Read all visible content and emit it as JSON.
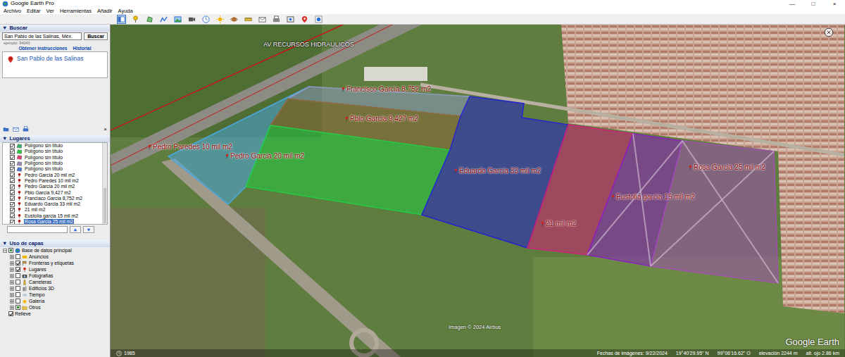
{
  "window": {
    "title": "Google Earth Pro",
    "controls": [
      "—",
      "□",
      "×"
    ]
  },
  "menu": [
    "Archivo",
    "Editar",
    "Ver",
    "Herramientas",
    "Añadir",
    "Ayuda"
  ],
  "toolbar": {
    "buttons": [
      {
        "selected": true
      },
      {
        "selected": false
      },
      {
        "selected": false
      },
      {
        "selected": false
      },
      {
        "selected": false
      },
      {
        "selected": false
      },
      {
        "selected": false
      },
      {
        "selected": false
      },
      {
        "selected": false
      },
      {
        "selected": false
      },
      {
        "selected": false
      },
      {
        "selected": false
      },
      {
        "selected": false
      },
      {
        "selected": false
      },
      {
        "selected": false
      }
    ]
  },
  "search": {
    "collapse": "▼",
    "header": "Buscar",
    "value": "San Pablo de las Salinas, Méx.",
    "button": "Buscar",
    "hint": "ejemplo: 94043",
    "links": [
      "Obtener instrucciones",
      "Historial"
    ],
    "results": [
      {
        "label": "San Pablo de las Salinas",
        "selected": false
      }
    ],
    "close": "×"
  },
  "places": {
    "collapse": "▼",
    "header": "Lugares",
    "items": [
      {
        "label": "Polígono sin título",
        "checked": true,
        "kind": "polygon",
        "color": "#3cb371",
        "selected": false
      },
      {
        "label": "Polígono sin título",
        "checked": true,
        "kind": "polygon",
        "color": "#2ecc40",
        "selected": false
      },
      {
        "label": "Polígono sin título",
        "checked": true,
        "kind": "polygon",
        "color": "#e04070",
        "selected": false
      },
      {
        "label": "Polígono sin título",
        "checked": true,
        "kind": "polygon",
        "color": "#9a8ab0",
        "selected": false
      },
      {
        "label": "Polígono sin título",
        "checked": true,
        "kind": "polygon",
        "color": "#4a7bd0",
        "selected": false
      },
      {
        "label": "Pedro Garcia 20 mil m2",
        "checked": true,
        "kind": "pin",
        "color": "#b01818",
        "selected": false
      },
      {
        "label": "Pedro Paredes 10 mil m2",
        "checked": true,
        "kind": "pin",
        "color": "#b01818",
        "selected": false
      },
      {
        "label": "Pedro Garcia 20 mil m2",
        "checked": true,
        "kind": "pin",
        "color": "#b01818",
        "selected": false
      },
      {
        "label": "Pblo Garcia 9,427 m2",
        "checked": true,
        "kind": "pin",
        "color": "#b01818",
        "selected": false
      },
      {
        "label": "Franciaco Garcia 8,752 m2",
        "checked": true,
        "kind": "pin",
        "color": "#b01818",
        "selected": false
      },
      {
        "label": "Eduardo Garcia 33 mil m2",
        "checked": true,
        "kind": "pin",
        "color": "#b01818",
        "selected": false
      },
      {
        "label": "21 mil m2",
        "checked": true,
        "kind": "pin",
        "color": "#b01818",
        "selected": false
      },
      {
        "label": "Eustolia garcia 15 mil m2",
        "checked": true,
        "kind": "pin",
        "color": "#b01818",
        "selected": false
      },
      {
        "label": "Rosa Garcia 25 mil m2",
        "checked": true,
        "kind": "pin",
        "color": "#b01818",
        "selected": true
      }
    ]
  },
  "layers": {
    "collapse": "▼",
    "header": "Uso de capas",
    "items": [
      {
        "label": "Base de datos principal",
        "kind": "root",
        "expanded": true,
        "checked": true,
        "partial": true
      },
      {
        "label": "Anuncios",
        "kind": "folder",
        "expanded": false,
        "checked": false,
        "partial": false
      },
      {
        "label": "Fronteras y etiquetas",
        "kind": "folder",
        "expanded": false,
        "checked": true,
        "partial": false
      },
      {
        "label": "Lugares",
        "kind": "folder",
        "expanded": false,
        "checked": true,
        "partial": false
      },
      {
        "label": "Fotografías",
        "kind": "folder",
        "expanded": false,
        "checked": false,
        "partial": false
      },
      {
        "label": "Carreteras",
        "kind": "folder",
        "expanded": false,
        "checked": false,
        "partial": false
      },
      {
        "label": "Edificios 3D",
        "kind": "folder",
        "expanded": false,
        "checked": false,
        "partial": false
      },
      {
        "label": "Tiempo",
        "kind": "folder",
        "expanded": false,
        "checked": false,
        "partial": false
      },
      {
        "label": "Galería",
        "kind": "folder",
        "expanded": false,
        "checked": false,
        "partial": false
      },
      {
        "label": "Otros",
        "kind": "folder",
        "expanded": false,
        "checked": true,
        "partial": true
      },
      {
        "label": "Relieve",
        "kind": "leaf",
        "expanded": false,
        "checked": true,
        "partial": false
      }
    ]
  },
  "map": {
    "road_label": "AV RECURSOS HIDRAULICOS",
    "parcels": [
      {
        "label": "Pedro Paredes 10 mil m2",
        "color": "#4aa8e0"
      },
      {
        "label": "Francisco Garcia 8,752 m2",
        "color": "#8a9bc0"
      },
      {
        "label": "Pblo Garcia 9,427 m2",
        "color": "#8a6a3a"
      },
      {
        "label": "Pedro Garcia 20 mil m2",
        "color": "#22cc44"
      },
      {
        "label": "Eduardo Garcia 33 mil m2",
        "color": "#2424cc"
      },
      {
        "label": "21 mil m2",
        "color": "#d0207a"
      },
      {
        "label": "Eustolia garcia 15 mil m2",
        "color": "#8a20c0"
      },
      {
        "label": "Rosa Garcia 25 mil m2",
        "color": "#a050b0"
      }
    ],
    "year": "1985",
    "footer": [
      "Fechas de imágenes: 9/22/2024",
      "19°40'29.95\" N",
      "99°06'16.62\" O",
      "elevación 2244 m",
      "alt. ojo 2.86 km"
    ],
    "credit": "Imagen © 2024 Airbus",
    "watermark": "Google Earth"
  }
}
